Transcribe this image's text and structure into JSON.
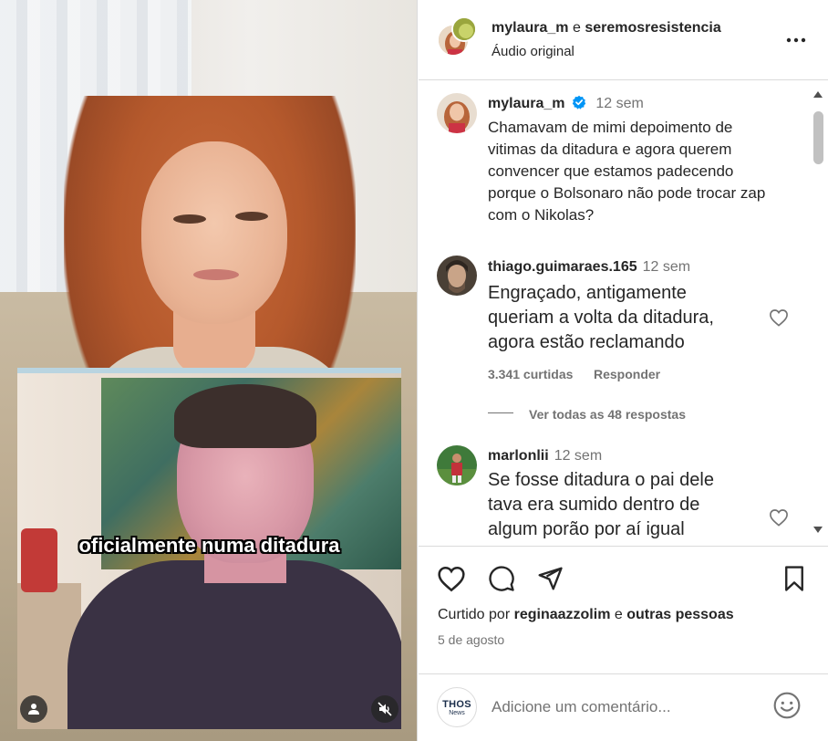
{
  "video": {
    "caption": "oficialmente numa ditadura"
  },
  "header": {
    "author": "mylaura_m",
    "connector": "e",
    "coauthor": "seremosresistencia",
    "audio": "Áudio original"
  },
  "post": {
    "username": "mylaura_m",
    "time": "12 sem",
    "text": "Chamavam de mimi depoimento de vitimas da  ditadura e agora querem convencer que estamos padecendo porque o Bolsonaro não  pode trocar zap com o Nikolas?"
  },
  "comments": [
    {
      "username": "thiago.guimaraes.165",
      "time": "12 sem",
      "text": [
        "Engraçado, antigamente",
        "queriam a volta da ditadura,",
        "agora estão reclamando"
      ],
      "likes": "3.341 curtidas",
      "reply": "Responder",
      "view_replies": "Ver todas as 48 respostas"
    },
    {
      "username": "marlonlii",
      "time": "12 sem",
      "text": [
        "Se fosse ditadura o pai dele",
        "tava era sumido dentro de",
        "algum porão por aí igual"
      ]
    }
  ],
  "actions": {
    "liked_by_prefix": "Curtido por",
    "liked_by_user": "reginaazzolim",
    "liked_by_connector": "e",
    "liked_by_others": "outras pessoas",
    "date": "5 de agosto"
  },
  "composer": {
    "placeholder": "Adicione um comentário...",
    "avatar_text_top": "THOS",
    "avatar_text_bottom": "News"
  },
  "colors": {
    "text": "#262626",
    "secondary": "#737373",
    "verified": "#0095f6",
    "border": "#dbdbdb"
  }
}
